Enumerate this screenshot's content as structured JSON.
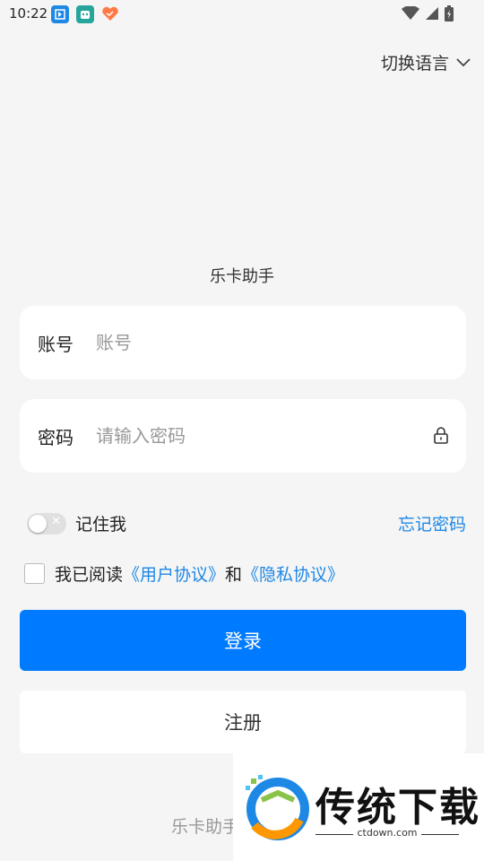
{
  "status_bar": {
    "time": "10:22"
  },
  "header": {
    "language_switch": "切换语言"
  },
  "app_name": "乐卡助手",
  "account_field": {
    "label": "账号",
    "placeholder": "账号",
    "value": ""
  },
  "password_field": {
    "label": "密码",
    "placeholder": "请输入密码",
    "value": ""
  },
  "remember": {
    "label": "记住我",
    "enabled": false
  },
  "forgot_password": "忘记密码",
  "agreement": {
    "checked": false,
    "prefix": "我已阅读",
    "user_agreement": "《用户协议》",
    "conjunction": "和",
    "privacy_policy": "《隐私协议》"
  },
  "buttons": {
    "login": "登录",
    "register": "注册"
  },
  "footer": {
    "text": "乐卡助手"
  },
  "watermark": {
    "title": "传统下载",
    "url": "ctdown.com"
  },
  "colors": {
    "accent": "#007aff",
    "link": "#1e88e5",
    "background": "#f5f5f5"
  }
}
